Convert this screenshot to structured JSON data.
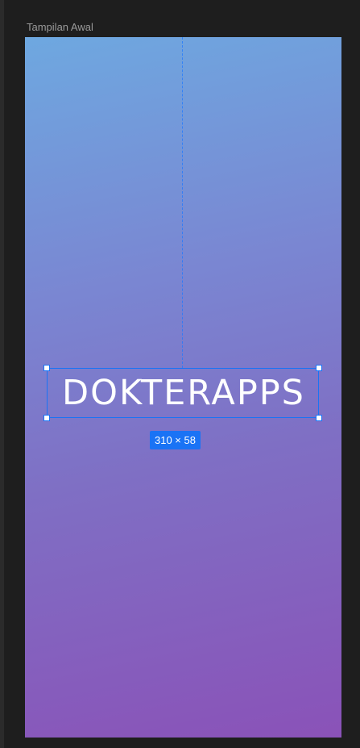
{
  "frame": {
    "label": "Tampilan Awal"
  },
  "selection": {
    "text": "DOKTERAPPS",
    "dimensions": "310 × 58"
  },
  "colors": {
    "canvas_background": "#1e1e1e",
    "gradient_top": "#6ea8e0",
    "gradient_bottom": "#8a52b8",
    "selection_accent": "#1a73f5"
  }
}
